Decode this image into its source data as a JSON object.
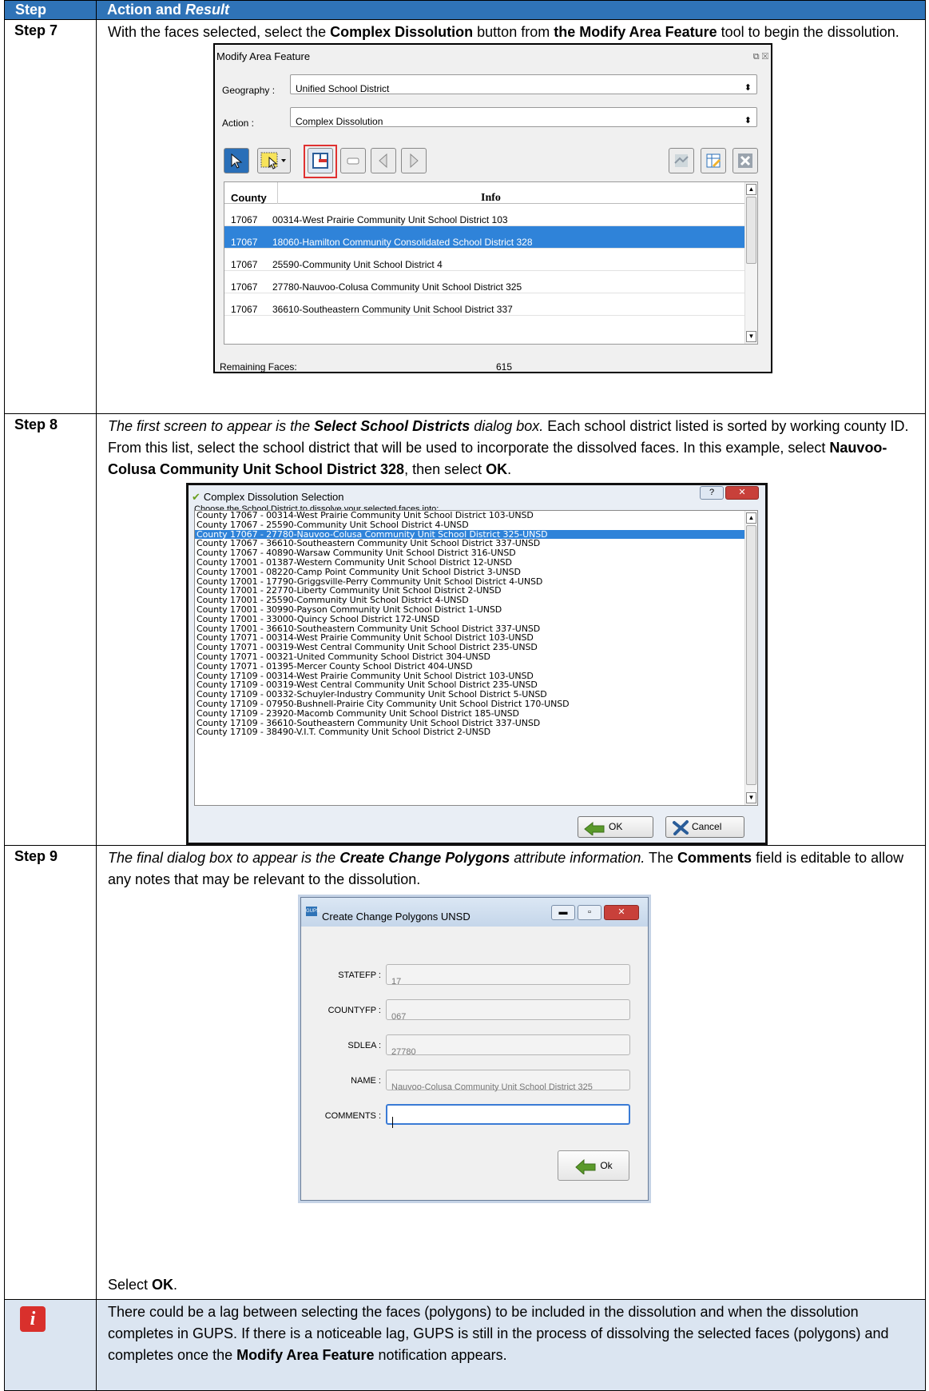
{
  "header": {
    "step": "Step",
    "action": "Action and ",
    "action_em": "Result"
  },
  "step7": {
    "label": "Step 7",
    "text_1": "With the faces selected, select the ",
    "text_b1": "Complex Dissolution",
    "text_2": " button from ",
    "text_b2": "the Modify Area Feature",
    "text_3": " tool to begin the dissolution.",
    "dialog": {
      "title": "Modify Area Feature",
      "geography_label": "Geography :",
      "geography_value": "Unified School District",
      "action_label": "Action :",
      "action_value": "Complex Dissolution",
      "col_county": "County",
      "col_info": "Info",
      "rows": [
        {
          "county": "17067",
          "info": "00314-West Prairie Community Unit School District 103"
        },
        {
          "county": "17067",
          "info": "18060-Hamilton Community Consolidated School District 328"
        },
        {
          "county": "17067",
          "info": "25590-Community Unit School District 4"
        },
        {
          "county": "17067",
          "info": "27780-Nauvoo-Colusa Community Unit School District 325"
        },
        {
          "county": "17067",
          "info": "36610-Southeastern Community Unit School District 337"
        }
      ],
      "remaining_label": "Remaining Faces:",
      "remaining_value": "615"
    }
  },
  "step8": {
    "label": "Step 8",
    "em_1": "The first screen to appear is the ",
    "em_b": "Select School Districts",
    "em_2": " dialog box.",
    "text_1": " Each school district listed is sorted by working county ID. From this list, select the school district that will be used to incorporate the dissolved faces. In this example, select ",
    "text_b1": "Nauvoo-Colusa Community Unit School District 328",
    "text_2": ", then select ",
    "text_b2": "OK",
    "text_3": ".",
    "dialog": {
      "title": "Complex Dissolution Selection",
      "subtitle": "Choose the School District to dissolve your selected faces into:",
      "items": [
        "County 17067 - 00314-West Prairie Community Unit School District 103-UNSD",
        "County 17067 - 25590-Community Unit School District 4-UNSD",
        "County 17067 - 27780-Nauvoo-Colusa Community Unit School District 325-UNSD",
        "County 17067 - 36610-Southeastern Community Unit School District 337-UNSD",
        "County 17067 - 40890-Warsaw Community Unit School District 316-UNSD",
        "County 17001 - 01387-Western Community Unit School District 12-UNSD",
        "County 17001 - 08220-Camp Point Community Unit School District 3-UNSD",
        "County 17001 - 17790-Griggsville-Perry Community Unit School District 4-UNSD",
        "County 17001 - 22770-Liberty Community Unit School District 2-UNSD",
        "County 17001 - 25590-Community Unit School District 4-UNSD",
        "County 17001 - 30990-Payson Community Unit School District 1-UNSD",
        "County 17001 - 33000-Quincy School District 172-UNSD",
        "County 17001 - 36610-Southeastern Community Unit School District 337-UNSD",
        "County 17071 - 00314-West Prairie Community Unit School District 103-UNSD",
        "County 17071 - 00319-West Central Community Unit School District 235-UNSD",
        "County 17071 - 00321-United Community School District 304-UNSD",
        "County 17071 - 01395-Mercer County School District 404-UNSD",
        "County 17109 - 00314-West Prairie Community Unit School District 103-UNSD",
        "County 17109 - 00319-West Central Community Unit School District 235-UNSD",
        "County 17109 - 00332-Schuyler-Industry Community Unit School District 5-UNSD",
        "County 17109 - 07950-Bushnell-Prairie City Community Unit School District 170-UNSD",
        "County 17109 - 23920-Macomb Community Unit School District 185-UNSD",
        "County 17109 - 36610-Southeastern Community Unit School District 337-UNSD",
        "County 17109 - 38490-V.I.T. Community Unit School District 2-UNSD"
      ],
      "selected_index": 2,
      "ok_label": "OK",
      "cancel_label": "Cancel"
    }
  },
  "step9": {
    "label": "Step 9",
    "em_1": "The final dialog box to appear is the ",
    "em_b": "Create Change Polygons",
    "em_2": " attribute information.",
    "text_1": " The ",
    "text_b1": "Comments",
    "text_2": " field is editable to allow any notes that may be relevant to the dissolution.",
    "dialog": {
      "title": "Create Change Polygons UNSD",
      "app_badge": "GUPS",
      "fields": [
        {
          "label": "STATEFP :",
          "value": "17"
        },
        {
          "label": "COUNTYFP :",
          "value": "067"
        },
        {
          "label": "SDLEA :",
          "value": "27780"
        },
        {
          "label": "NAME :",
          "value": "Nauvoo-Colusa Community Unit School District 325"
        },
        {
          "label": "COMMENTS :",
          "value": ""
        }
      ],
      "ok_label": "Ok"
    },
    "select_text": "Select ",
    "select_b": "OK",
    "select_end": "."
  },
  "note": {
    "icon": "info-icon",
    "text_1": "There could be a lag between selecting the faces (polygons) to be included in the dissolution and when the dissolution completes in GUPS. If there is a noticeable lag, GUPS is still in the process of dissolving the selected faces (polygons) and completes once the ",
    "text_b": "Modify Area Feature",
    "text_2": " notification appears."
  },
  "colors": {
    "header_bg": "#2f73b7",
    "note_bg": "#dbe5f1",
    "selection": "#2f83d9",
    "highlight": "#e03131"
  }
}
